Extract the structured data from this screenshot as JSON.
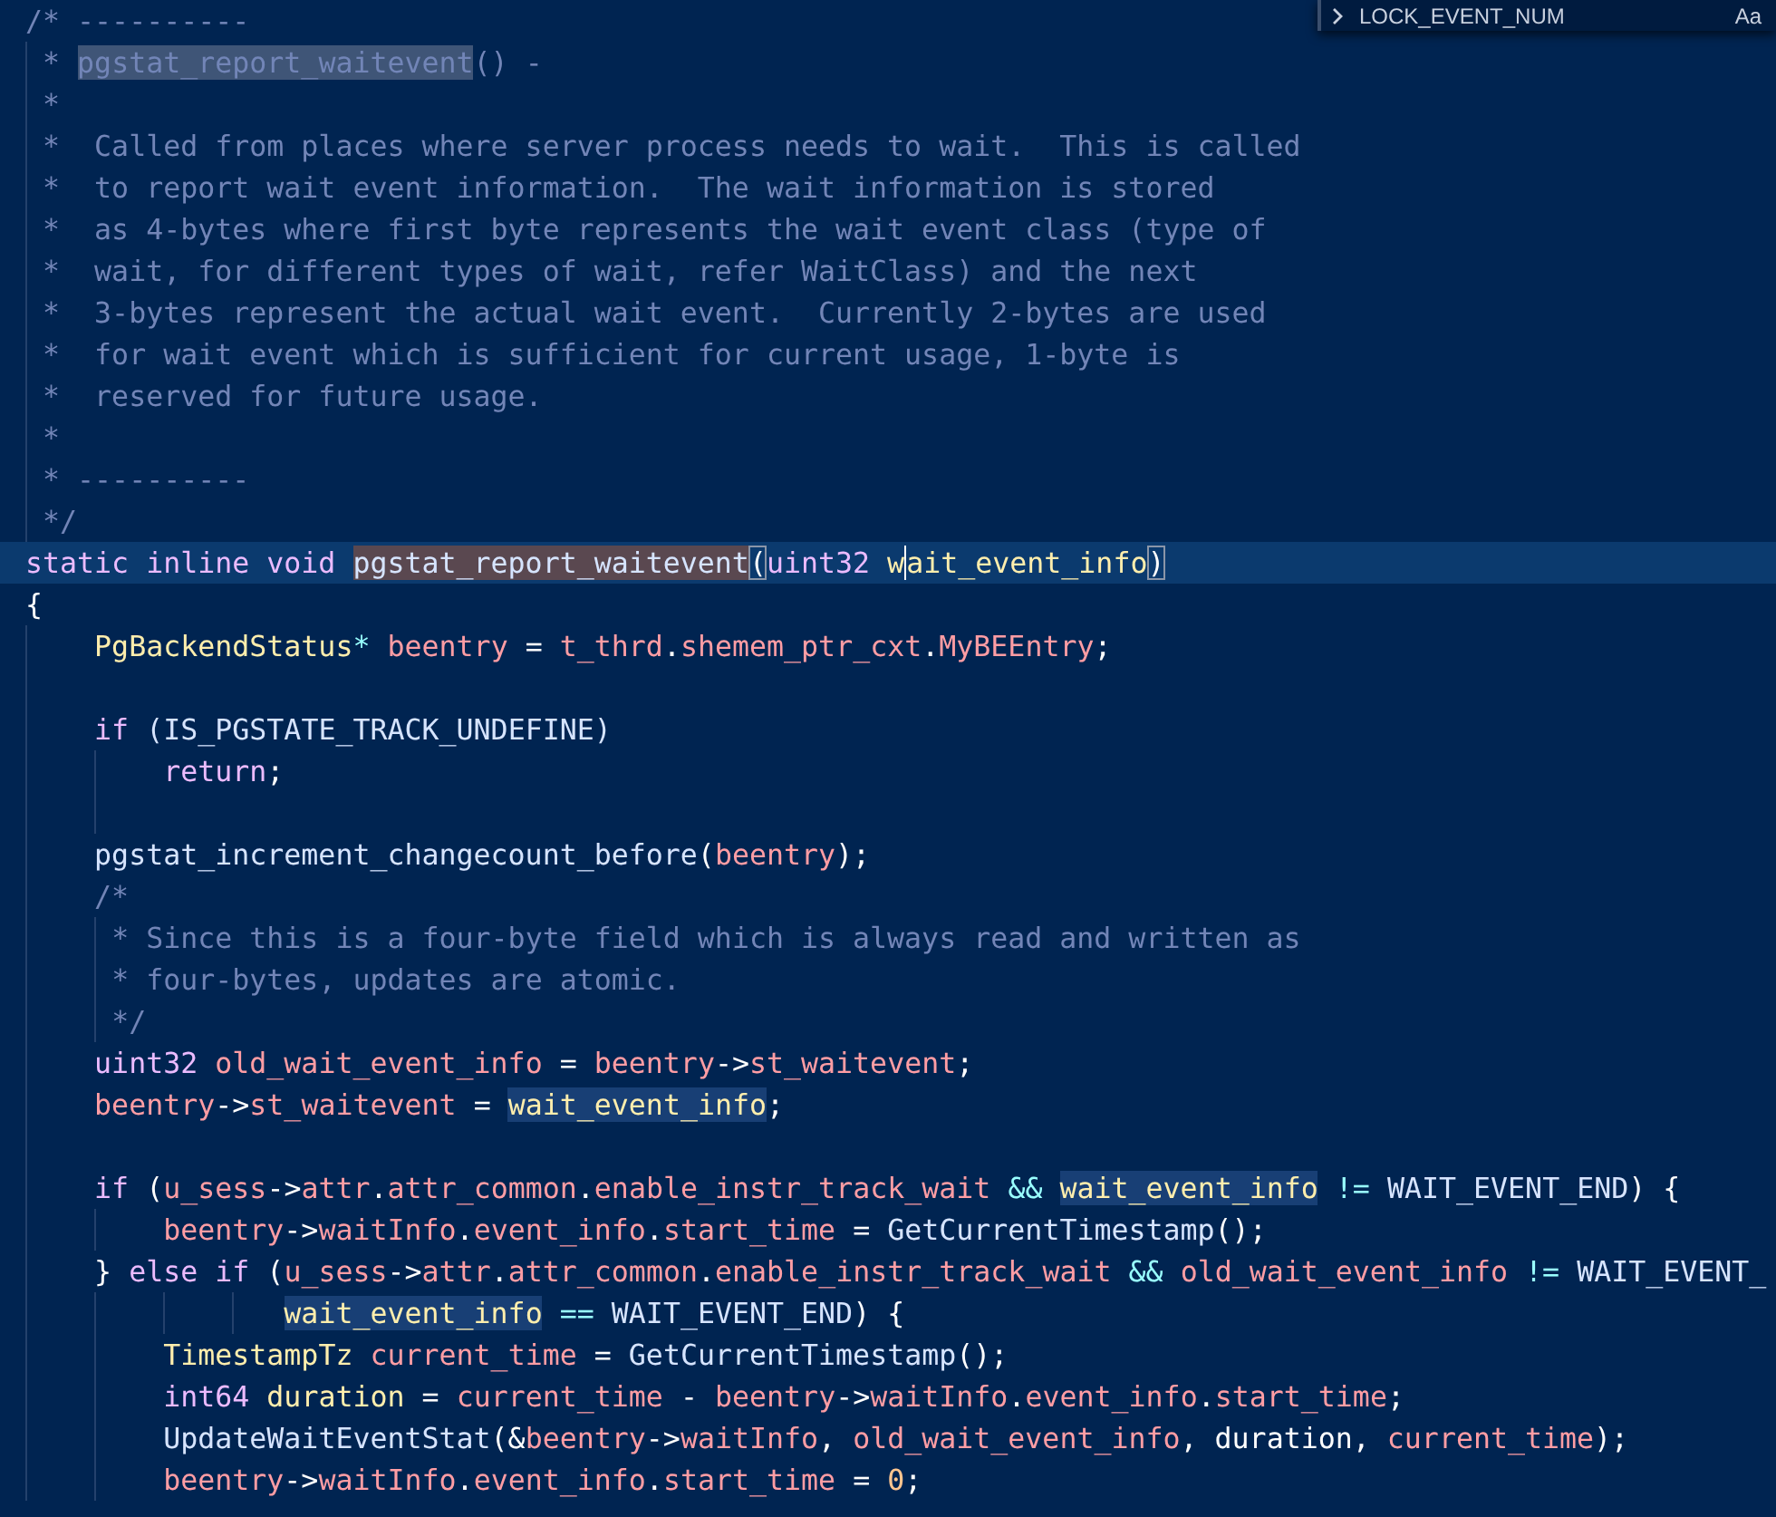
{
  "find_widget": {
    "query": "LOCK_EVENT_NUM",
    "match_case_label": "Aa"
  },
  "lines": [
    {
      "kind": "code",
      "tokens": [
        {
          "text": "/* ----------",
          "kind": "comment"
        }
      ]
    },
    {
      "kind": "code",
      "tokens": [
        {
          "text": " * ",
          "kind": "comment"
        },
        {
          "text": "pgstat_report_waitevent",
          "kind": "comment",
          "matched": true
        },
        {
          "text": "() -",
          "kind": "comment"
        }
      ]
    },
    {
      "kind": "code",
      "tokens": [
        {
          "text": " *",
          "kind": "comment"
        }
      ]
    },
    {
      "kind": "code",
      "tokens": [
        {
          "text": " *  Called from places where server process needs to wait.  This is called",
          "kind": "comment"
        }
      ]
    },
    {
      "kind": "code",
      "tokens": [
        {
          "text": " *  to report wait event information.  The wait information is stored",
          "kind": "comment"
        }
      ]
    },
    {
      "kind": "code",
      "tokens": [
        {
          "text": " *  as 4-bytes where first byte represents the wait event class (type of",
          "kind": "comment"
        }
      ]
    },
    {
      "kind": "code",
      "tokens": [
        {
          "text": " *  wait, for different types of wait, refer WaitClass) and the next",
          "kind": "comment"
        }
      ]
    },
    {
      "kind": "code",
      "tokens": [
        {
          "text": " *  3-bytes represent the actual wait event.  Currently 2-bytes are used",
          "kind": "comment"
        }
      ]
    },
    {
      "kind": "code",
      "tokens": [
        {
          "text": " *  for wait event which is sufficient for current usage, 1-byte is",
          "kind": "comment"
        }
      ]
    },
    {
      "kind": "code",
      "tokens": [
        {
          "text": " *  reserved for future usage.",
          "kind": "comment"
        }
      ]
    },
    {
      "kind": "code",
      "tokens": [
        {
          "text": " *",
          "kind": "comment"
        }
      ]
    },
    {
      "kind": "code",
      "tokens": [
        {
          "text": " * ----------",
          "kind": "comment"
        }
      ]
    },
    {
      "kind": "code",
      "tokens": [
        {
          "text": " */",
          "kind": "comment"
        }
      ]
    },
    {
      "kind": "code",
      "current": true,
      "tokens": [
        {
          "text": "static inline void ",
          "kind": "keyword"
        },
        {
          "text": "pgstat_report_waitevent",
          "kind": "function",
          "selected": true
        },
        {
          "text": "(",
          "kind": "plain",
          "bracket_match": true
        },
        {
          "text": "uint32 ",
          "kind": "keyword"
        },
        {
          "text": "w",
          "kind": "param"
        },
        {
          "text": "ait_event_info",
          "kind": "param",
          "cursor_before": true
        },
        {
          "text": ")",
          "kind": "plain",
          "bracket_match": true
        }
      ]
    },
    {
      "kind": "code",
      "tokens": [
        {
          "text": "{",
          "kind": "plain"
        }
      ]
    },
    {
      "kind": "code",
      "tokens": [
        {
          "text": "    PgBackendStatus",
          "kind": "type"
        },
        {
          "text": "* ",
          "kind": "operator"
        },
        {
          "text": "beentry",
          "kind": "variable"
        },
        {
          "text": " = ",
          "kind": "plain"
        },
        {
          "text": "t_thrd",
          "kind": "variable"
        },
        {
          "text": ".",
          "kind": "plain"
        },
        {
          "text": "shemem_ptr_cxt",
          "kind": "variable"
        },
        {
          "text": ".",
          "kind": "plain"
        },
        {
          "text": "MyBEEntry",
          "kind": "variable"
        },
        {
          "text": ";",
          "kind": "plain"
        }
      ]
    },
    {
      "kind": "blank"
    },
    {
      "kind": "code",
      "tokens": [
        {
          "text": "    if",
          "kind": "keyword"
        },
        {
          "text": " (IS_PGSTATE_TRACK_UNDEFINE)",
          "kind": "function"
        }
      ]
    },
    {
      "kind": "code",
      "tokens": [
        {
          "text": "        return",
          "kind": "keyword"
        },
        {
          "text": ";",
          "kind": "plain"
        }
      ]
    },
    {
      "kind": "blank"
    },
    {
      "kind": "code",
      "tokens": [
        {
          "text": "    pgstat_increment_changecount_before",
          "kind": "function"
        },
        {
          "text": "(",
          "kind": "plain"
        },
        {
          "text": "beentry",
          "kind": "variable"
        },
        {
          "text": ");",
          "kind": "plain"
        }
      ]
    },
    {
      "kind": "code",
      "tokens": [
        {
          "text": "    /*",
          "kind": "comment"
        }
      ]
    },
    {
      "kind": "code",
      "tokens": [
        {
          "text": "     * Since this is a four-byte field which is always read and written as",
          "kind": "comment"
        }
      ]
    },
    {
      "kind": "code",
      "tokens": [
        {
          "text": "     * four-bytes, updates are atomic.",
          "kind": "comment"
        }
      ]
    },
    {
      "kind": "code",
      "tokens": [
        {
          "text": "     */",
          "kind": "comment"
        }
      ]
    },
    {
      "kind": "code",
      "tokens": [
        {
          "text": "    uint32 ",
          "kind": "keyword"
        },
        {
          "text": "old_wait_event_info",
          "kind": "variable"
        },
        {
          "text": " = ",
          "kind": "plain"
        },
        {
          "text": "beentry",
          "kind": "variable"
        },
        {
          "text": "->",
          "kind": "plain"
        },
        {
          "text": "st_waitevent",
          "kind": "variable"
        },
        {
          "text": ";",
          "kind": "plain"
        }
      ]
    },
    {
      "kind": "code",
      "tokens": [
        {
          "text": "    beentry",
          "kind": "variable"
        },
        {
          "text": "->",
          "kind": "plain"
        },
        {
          "text": "st_waitevent",
          "kind": "variable"
        },
        {
          "text": " = ",
          "kind": "plain"
        },
        {
          "text": "wait_event_info",
          "kind": "param",
          "occurrence": true
        },
        {
          "text": ";",
          "kind": "plain"
        }
      ]
    },
    {
      "kind": "blank"
    },
    {
      "kind": "code",
      "tokens": [
        {
          "text": "    if",
          "kind": "keyword"
        },
        {
          "text": " (",
          "kind": "plain"
        },
        {
          "text": "u_sess",
          "kind": "variable"
        },
        {
          "text": "->",
          "kind": "plain"
        },
        {
          "text": "attr",
          "kind": "variable"
        },
        {
          "text": ".",
          "kind": "plain"
        },
        {
          "text": "attr_common",
          "kind": "variable"
        },
        {
          "text": ".",
          "kind": "plain"
        },
        {
          "text": "enable_instr_track_wait",
          "kind": "variable"
        },
        {
          "text": " && ",
          "kind": "operator"
        },
        {
          "text": "wait_event_info",
          "kind": "param",
          "occurrence": true
        },
        {
          "text": " != ",
          "kind": "operator"
        },
        {
          "text": "WAIT_EVENT_END",
          "kind": "function"
        },
        {
          "text": ") {",
          "kind": "plain"
        }
      ]
    },
    {
      "kind": "code",
      "tokens": [
        {
          "text": "        beentry",
          "kind": "variable"
        },
        {
          "text": "->",
          "kind": "plain"
        },
        {
          "text": "waitInfo",
          "kind": "variable"
        },
        {
          "text": ".",
          "kind": "plain"
        },
        {
          "text": "event_info",
          "kind": "variable"
        },
        {
          "text": ".",
          "kind": "plain"
        },
        {
          "text": "start_time",
          "kind": "variable"
        },
        {
          "text": " = ",
          "kind": "plain"
        },
        {
          "text": "GetCurrentTimestamp",
          "kind": "function"
        },
        {
          "text": "();",
          "kind": "plain"
        }
      ]
    },
    {
      "kind": "code",
      "tokens": [
        {
          "text": "    } ",
          "kind": "plain"
        },
        {
          "text": "else if",
          "kind": "keyword"
        },
        {
          "text": " (",
          "kind": "plain"
        },
        {
          "text": "u_sess",
          "kind": "variable"
        },
        {
          "text": "->",
          "kind": "plain"
        },
        {
          "text": "attr",
          "kind": "variable"
        },
        {
          "text": ".",
          "kind": "plain"
        },
        {
          "text": "attr_common",
          "kind": "variable"
        },
        {
          "text": ".",
          "kind": "plain"
        },
        {
          "text": "enable_instr_track_wait",
          "kind": "variable"
        },
        {
          "text": " && ",
          "kind": "operator"
        },
        {
          "text": "old_wait_event_info",
          "kind": "variable"
        },
        {
          "text": " != ",
          "kind": "operator"
        },
        {
          "text": "WAIT_EVENT_",
          "kind": "function"
        }
      ]
    },
    {
      "kind": "code",
      "tokens": [
        {
          "text": "               wait_event_info",
          "kind": "param",
          "occurrence": true
        },
        {
          "text": " == ",
          "kind": "operator"
        },
        {
          "text": "WAIT_EVENT_END",
          "kind": "function"
        },
        {
          "text": ") {",
          "kind": "plain"
        }
      ]
    },
    {
      "kind": "code",
      "tokens": [
        {
          "text": "        TimestampTz",
          "kind": "type"
        },
        {
          "text": " current_time",
          "kind": "variable"
        },
        {
          "text": " = ",
          "kind": "plain"
        },
        {
          "text": "GetCurrentTimestamp",
          "kind": "function"
        },
        {
          "text": "();",
          "kind": "plain"
        }
      ]
    },
    {
      "kind": "code",
      "tokens": [
        {
          "text": "        int64 ",
          "kind": "keyword"
        },
        {
          "text": "duration",
          "kind": "param"
        },
        {
          "text": " = ",
          "kind": "plain"
        },
        {
          "text": "current_time",
          "kind": "variable"
        },
        {
          "text": " - ",
          "kind": "plain"
        },
        {
          "text": "beentry",
          "kind": "variable"
        },
        {
          "text": "->",
          "kind": "plain"
        },
        {
          "text": "waitInfo",
          "kind": "variable"
        },
        {
          "text": ".",
          "kind": "plain"
        },
        {
          "text": "event_info",
          "kind": "variable"
        },
        {
          "text": ".",
          "kind": "plain"
        },
        {
          "text": "start_time",
          "kind": "variable"
        },
        {
          "text": ";",
          "kind": "plain"
        }
      ]
    },
    {
      "kind": "code",
      "tokens": [
        {
          "text": "        UpdateWaitEventStat",
          "kind": "function"
        },
        {
          "text": "(&",
          "kind": "plain"
        },
        {
          "text": "beentry",
          "kind": "variable"
        },
        {
          "text": "->",
          "kind": "plain"
        },
        {
          "text": "waitInfo",
          "kind": "variable"
        },
        {
          "text": ", ",
          "kind": "plain"
        },
        {
          "text": "old_wait_event_info",
          "kind": "variable"
        },
        {
          "text": ", duration, ",
          "kind": "plain"
        },
        {
          "text": "current_time",
          "kind": "variable"
        },
        {
          "text": ");",
          "kind": "plain"
        }
      ]
    },
    {
      "kind": "code",
      "tokens": [
        {
          "text": "        beentry",
          "kind": "variable"
        },
        {
          "text": "->",
          "kind": "plain"
        },
        {
          "text": "waitInfo",
          "kind": "variable"
        },
        {
          "text": ".",
          "kind": "plain"
        },
        {
          "text": "event_info",
          "kind": "variable"
        },
        {
          "text": ".",
          "kind": "plain"
        },
        {
          "text": "start_time",
          "kind": "variable"
        },
        {
          "text": " = ",
          "kind": "plain"
        },
        {
          "text": "0",
          "kind": "number"
        },
        {
          "text": ";",
          "kind": "plain"
        }
      ]
    }
  ]
}
